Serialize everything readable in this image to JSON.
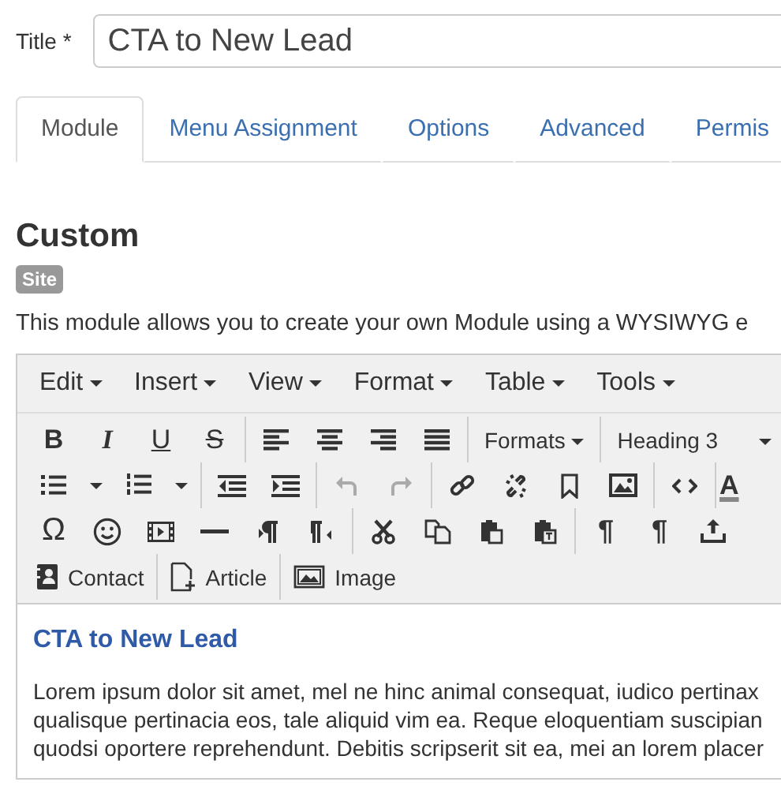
{
  "title_field": {
    "label": "Title *",
    "value": "CTA to New Lead"
  },
  "tabs": [
    {
      "label": "Module",
      "selected": true
    },
    {
      "label": "Menu Assignment",
      "selected": false
    },
    {
      "label": "Options",
      "selected": false
    },
    {
      "label": "Advanced",
      "selected": false
    },
    {
      "label": "Permis",
      "selected": false
    }
  ],
  "module": {
    "heading": "Custom",
    "badge": "Site",
    "description": "This module allows you to create your own Module using a WYSIWYG e"
  },
  "editor": {
    "menus": [
      "Edit",
      "Insert",
      "View",
      "Format",
      "Table",
      "Tools"
    ],
    "format_glyphs": [
      {
        "glyph": "B",
        "kind": "bold"
      },
      {
        "glyph": "I",
        "kind": "italic"
      },
      {
        "glyph": "U",
        "kind": "underline"
      },
      {
        "glyph": "S",
        "kind": "strike"
      }
    ],
    "formats_dropdown": "Formats",
    "block_dropdown": "Heading 3",
    "text_color_glyph": "A",
    "special_char_glyph": "Ω",
    "pilcrow_glyphs": [
      "¶",
      "¶"
    ],
    "insert_buttons": [
      {
        "label": "Contact",
        "kind": "contact"
      },
      {
        "label": "Article",
        "kind": "article"
      },
      {
        "label": "Image",
        "kind": "image"
      }
    ],
    "content": {
      "heading": "CTA to New Lead",
      "lines": [
        "Lorem ipsum dolor sit amet, mel ne hinc animal consequat, iudico pertinax",
        "qualisque pertinacia eos, tale aliquid vim ea. Reque eloquentiam suscipian",
        "quodsi oportere reprehendunt. Debitis scripserit sit ea, mei an lorem placer"
      ]
    }
  }
}
